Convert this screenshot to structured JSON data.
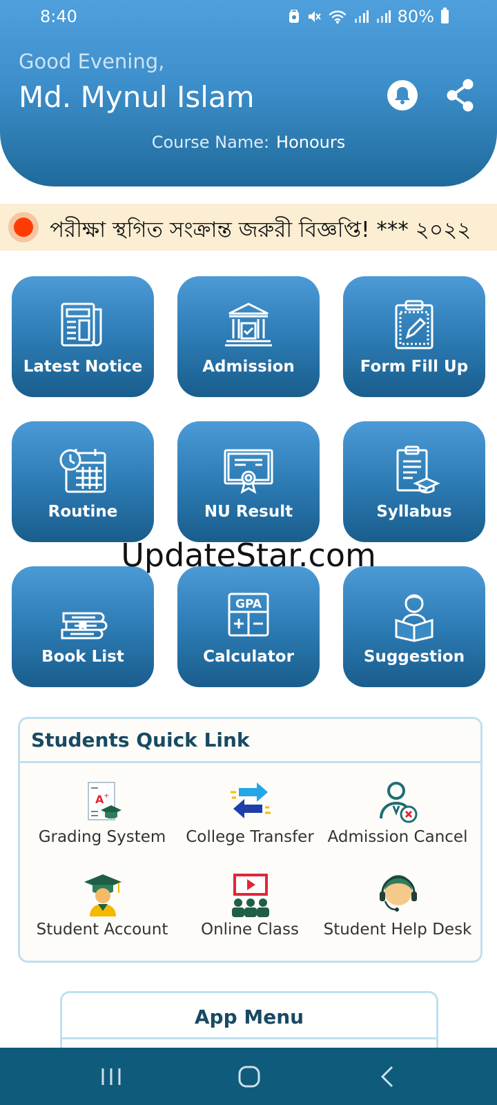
{
  "status": {
    "time": "8:40",
    "battery": "80%",
    "icons": [
      "security-icon",
      "mute-icon",
      "wifi-icon",
      "signal-icon",
      "signal-icon",
      "battery-icon"
    ]
  },
  "header": {
    "greeting": "Good Evening,",
    "name": "Md. Mynul Islam",
    "course_label": "Course Name:",
    "course_value": "Honours",
    "icons": [
      "bell-icon",
      "share-icon"
    ]
  },
  "notice": {
    "text": "পরীক্ষা স্থগিত সংক্রান্ত জরুরী বিজ্ঞপ্তি! *** ২০২২",
    "dot_color": "#ff3b05",
    "background": "#fbeed3"
  },
  "tiles": [
    {
      "label": "Latest Notice",
      "icon": "newspaper-icon"
    },
    {
      "label": "Admission",
      "icon": "institution-icon"
    },
    {
      "label": "Form Fill Up",
      "icon": "clipboard-edit-icon"
    },
    {
      "label": "Routine",
      "icon": "calendar-clock-icon"
    },
    {
      "label": "NU Result",
      "icon": "certificate-icon"
    },
    {
      "label": "Syllabus",
      "icon": "syllabus-icon"
    },
    {
      "label": "Book List",
      "icon": "books-icon"
    },
    {
      "label": "Calculator",
      "icon": "gpa-calculator-icon"
    },
    {
      "label": "Suggestion",
      "icon": "reader-icon"
    }
  ],
  "quick_links": {
    "title": "Students Quick Link",
    "items": [
      {
        "label": "Grading System",
        "icon": "grade-sheet-icon"
      },
      {
        "label": "College Transfer",
        "icon": "transfer-arrows-icon"
      },
      {
        "label": "Admission Cancel",
        "icon": "user-cancel-icon"
      },
      {
        "label": "Student Account",
        "icon": "graduate-icon"
      },
      {
        "label": "Online Class",
        "icon": "online-class-icon"
      },
      {
        "label": "Student Help Desk",
        "icon": "help-desk-icon"
      }
    ]
  },
  "app_menu": {
    "title": "App Menu"
  },
  "watermark": "UpdateStar.com",
  "colors": {
    "primary": "#2d7cb5",
    "primary_dark": "#195d8c",
    "nav_bar": "#0f5b7c",
    "card_border": "#bfe0ef",
    "heading": "#184a63"
  },
  "nav": [
    "recents-icon",
    "home-icon",
    "back-icon"
  ]
}
